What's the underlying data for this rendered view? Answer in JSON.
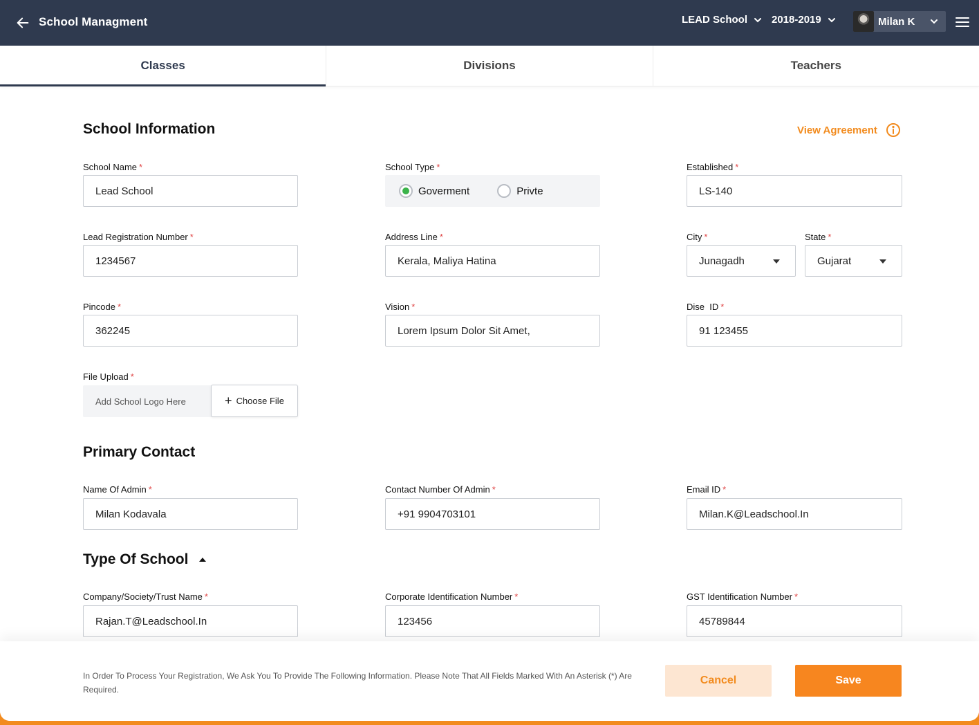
{
  "header": {
    "title": "School Managment",
    "school_select": "LEAD School",
    "year_select": "2018-2019",
    "user_name": "Milan K"
  },
  "tabs": [
    {
      "label": "Classes",
      "active": true
    },
    {
      "label": "Divisions",
      "active": false
    },
    {
      "label": "Teachers",
      "active": false
    }
  ],
  "school_info": {
    "title": "School Information",
    "view_agreement": "View Agreement",
    "school_name": {
      "label": "School Name",
      "value": "Lead School"
    },
    "school_type": {
      "label": "School Type",
      "options": [
        "Goverment",
        "Privte"
      ],
      "selected": "Goverment"
    },
    "established": {
      "label": "Established",
      "value": "LS-140"
    },
    "registration": {
      "label": "Lead Registration Number",
      "value": "1234567"
    },
    "address": {
      "label": "Address Line",
      "value": "Kerala, Maliya Hatina"
    },
    "city": {
      "label": "City",
      "value": "Junagadh"
    },
    "state": {
      "label": "State",
      "value": "Gujarat"
    },
    "pincode": {
      "label": "Pincode",
      "value": "362245"
    },
    "vision": {
      "label": "Vision",
      "value": "Lorem Ipsum Dolor Sit Amet,"
    },
    "dise_id": {
      "label": "Dise  ID",
      "value": "91 123455"
    },
    "file_upload": {
      "label": "File Upload",
      "placeholder": "Add School Logo Here",
      "button": "Choose File"
    }
  },
  "primary_contact": {
    "title": "Primary Contact",
    "admin_name": {
      "label": "Name Of Admin",
      "value": "Milan Kodavala"
    },
    "admin_contact": {
      "label": "Contact Number Of Admin",
      "value": "+91 9904703101"
    },
    "email": {
      "label": "Email ID",
      "value": "Milan.K@Leadschool.In"
    }
  },
  "type_of_school": {
    "title": "Type Of School",
    "trust_name": {
      "label": "Company/Society/Trust Name",
      "value": "Rajan.T@Leadschool.In"
    },
    "cin": {
      "label": "Corporate Identification Number",
      "value": "123456"
    },
    "gst": {
      "label": "GST Identification Number",
      "value": "45789844"
    }
  },
  "footer": {
    "note": "In Order To Process Your Registration, We Ask You To Provide The Following Information. Please Note That All Fields Marked With An Asterisk (*) Are Required.",
    "cancel": "Cancel",
    "save": "Save"
  },
  "required_mark": "*",
  "colors": {
    "header_bg": "#2f3a4f",
    "accent": "#f28b1e",
    "radio_on": "#3bb34a",
    "required": "#e04848"
  }
}
